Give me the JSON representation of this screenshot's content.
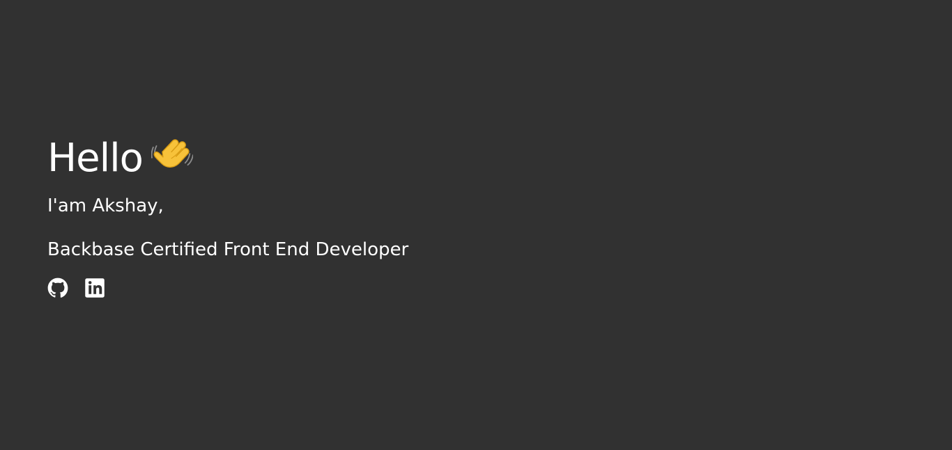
{
  "hero": {
    "greeting": "Hello",
    "greeting_emoji": "waving-hand-icon",
    "intro": "I'am Akshay,",
    "role": "Backbase Certified Front End Developer"
  },
  "social": {
    "links": [
      {
        "icon": "github-icon"
      },
      {
        "icon": "linkedin-icon"
      }
    ]
  },
  "colors": {
    "background": "#313131",
    "text": "#ffffff",
    "wave": "#f7c23a"
  }
}
